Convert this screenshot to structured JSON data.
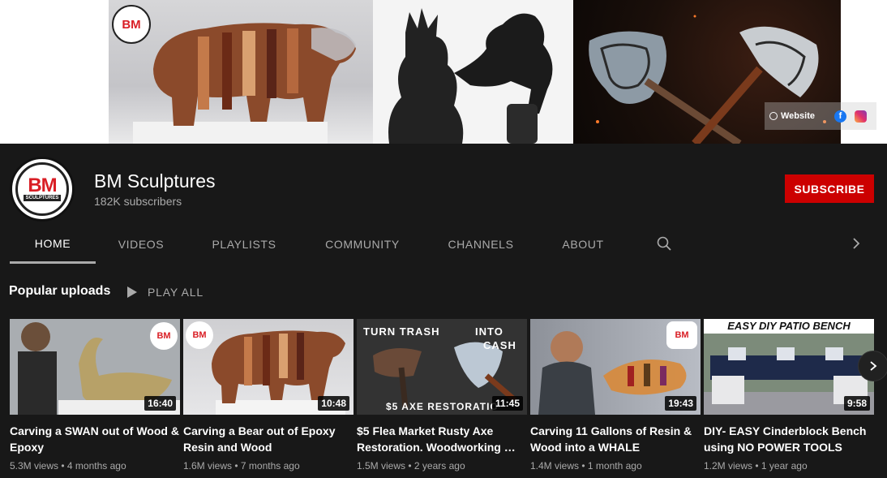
{
  "banner": {
    "website_label": "Website"
  },
  "channel": {
    "avatar_text": "BM",
    "avatar_subtext": "SCULPTURES",
    "name": "BM Sculptures",
    "subscribers": "182K subscribers",
    "subscribe_label": "SUBSCRIBE"
  },
  "tabs": [
    {
      "label": "HOME"
    },
    {
      "label": "VIDEOS"
    },
    {
      "label": "PLAYLISTS"
    },
    {
      "label": "COMMUNITY"
    },
    {
      "label": "CHANNELS"
    },
    {
      "label": "ABOUT"
    }
  ],
  "shelf": {
    "title": "Popular uploads",
    "play_all": "PLAY ALL"
  },
  "videos": [
    {
      "title": "Carving a SWAN out of Wood & Epoxy",
      "views": "5.3M views",
      "age": "4 months ago",
      "duration": "16:40",
      "badge": "BM"
    },
    {
      "title": "Carving a Bear out of Epoxy Resin and Wood",
      "views": "1.6M views",
      "age": "7 months ago",
      "duration": "10:48",
      "badge": "BM"
    },
    {
      "title": "$5 Flea Market Rusty Axe Restoration. Woodworking …",
      "views": "1.5M views",
      "age": "2 years ago",
      "duration": "11:45",
      "overlay_top1": "TURN TRASH",
      "overlay_top2": "INTO",
      "overlay_top3": "CASH",
      "overlay_bottom": "$5 AXE RESTORATIO"
    },
    {
      "title": "Carving 11 Gallons of Resin & Wood into a WHALE",
      "views": "1.4M views",
      "age": "1 month ago",
      "duration": "19:43",
      "badge": "BM"
    },
    {
      "title": "DIY- EASY Cinderblock Bench using NO POWER TOOLS",
      "views": "1.2M views",
      "age": "1 year ago",
      "duration": "9:58",
      "overlay_top": "EASY DIY PATIO BENCH"
    }
  ],
  "colors": {
    "subscribe_red": "#cc0000",
    "background": "#181818",
    "brand_red": "#d91e25"
  }
}
